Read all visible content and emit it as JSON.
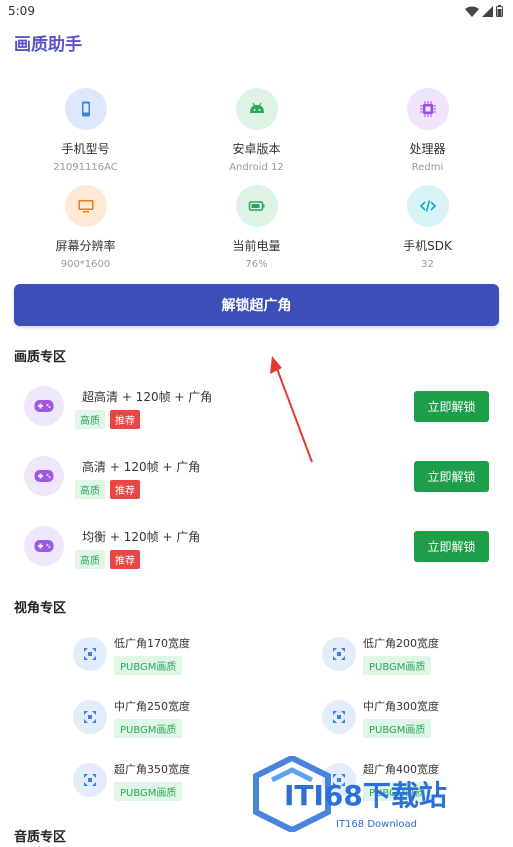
{
  "status": {
    "time": "5:09"
  },
  "app": {
    "title": "画质助手"
  },
  "device_info": [
    {
      "label": "手机型号",
      "value": "21091116AC",
      "icon": "phone-icon",
      "bg": "#dde8fb",
      "fg": "#3f7fe0"
    },
    {
      "label": "安卓版本",
      "value": "Android 12",
      "icon": "android-icon",
      "bg": "#ddf3e4",
      "fg": "#2fa558"
    },
    {
      "label": "处理器",
      "value": "Redmi",
      "icon": "chip-icon",
      "bg": "#efe4fb",
      "fg": "#9b4fe0"
    },
    {
      "label": "屏幕分辨率",
      "value": "900*1600",
      "icon": "monitor-icon",
      "bg": "#fde9d6",
      "fg": "#e87b1c"
    },
    {
      "label": "当前电量",
      "value": "76%",
      "icon": "battery-icon",
      "bg": "#ddf3e4",
      "fg": "#2fa558"
    },
    {
      "label": "手机SDK",
      "value": "32",
      "icon": "code-icon",
      "bg": "#d8f3f8",
      "fg": "#17a8c8"
    }
  ],
  "unlock_wide_label": "解锁超广角",
  "quality_section": {
    "title": "画质专区",
    "items": [
      {
        "name": "超高清 + 120帧 + 广角",
        "tag1": "高质",
        "tag2": "推荐",
        "button": "立即解锁"
      },
      {
        "name": "高清 + 120帧 + 广角",
        "tag1": "高质",
        "tag2": "推荐",
        "button": "立即解锁"
      },
      {
        "name": "均衡 + 120帧 + 广角",
        "tag1": "高质",
        "tag2": "推荐",
        "button": "立即解锁"
      }
    ]
  },
  "view_section": {
    "title": "视角专区",
    "items": [
      {
        "name": "低广角170宽度",
        "tag": "PUBGM画质"
      },
      {
        "name": "低广角200宽度",
        "tag": "PUBGM画质"
      },
      {
        "name": "中广角250宽度",
        "tag": "PUBGM画质"
      },
      {
        "name": "中广角300宽度",
        "tag": "PUBGM画质"
      },
      {
        "name": "超广角350宽度",
        "tag": "PUBGM画质"
      },
      {
        "name": "超广角400宽度",
        "tag": "PUBGM画质"
      }
    ]
  },
  "audio_section": {
    "title": "音质专区"
  },
  "watermark": {
    "text": "ITI68下载站",
    "sub": "IT168 Download"
  }
}
